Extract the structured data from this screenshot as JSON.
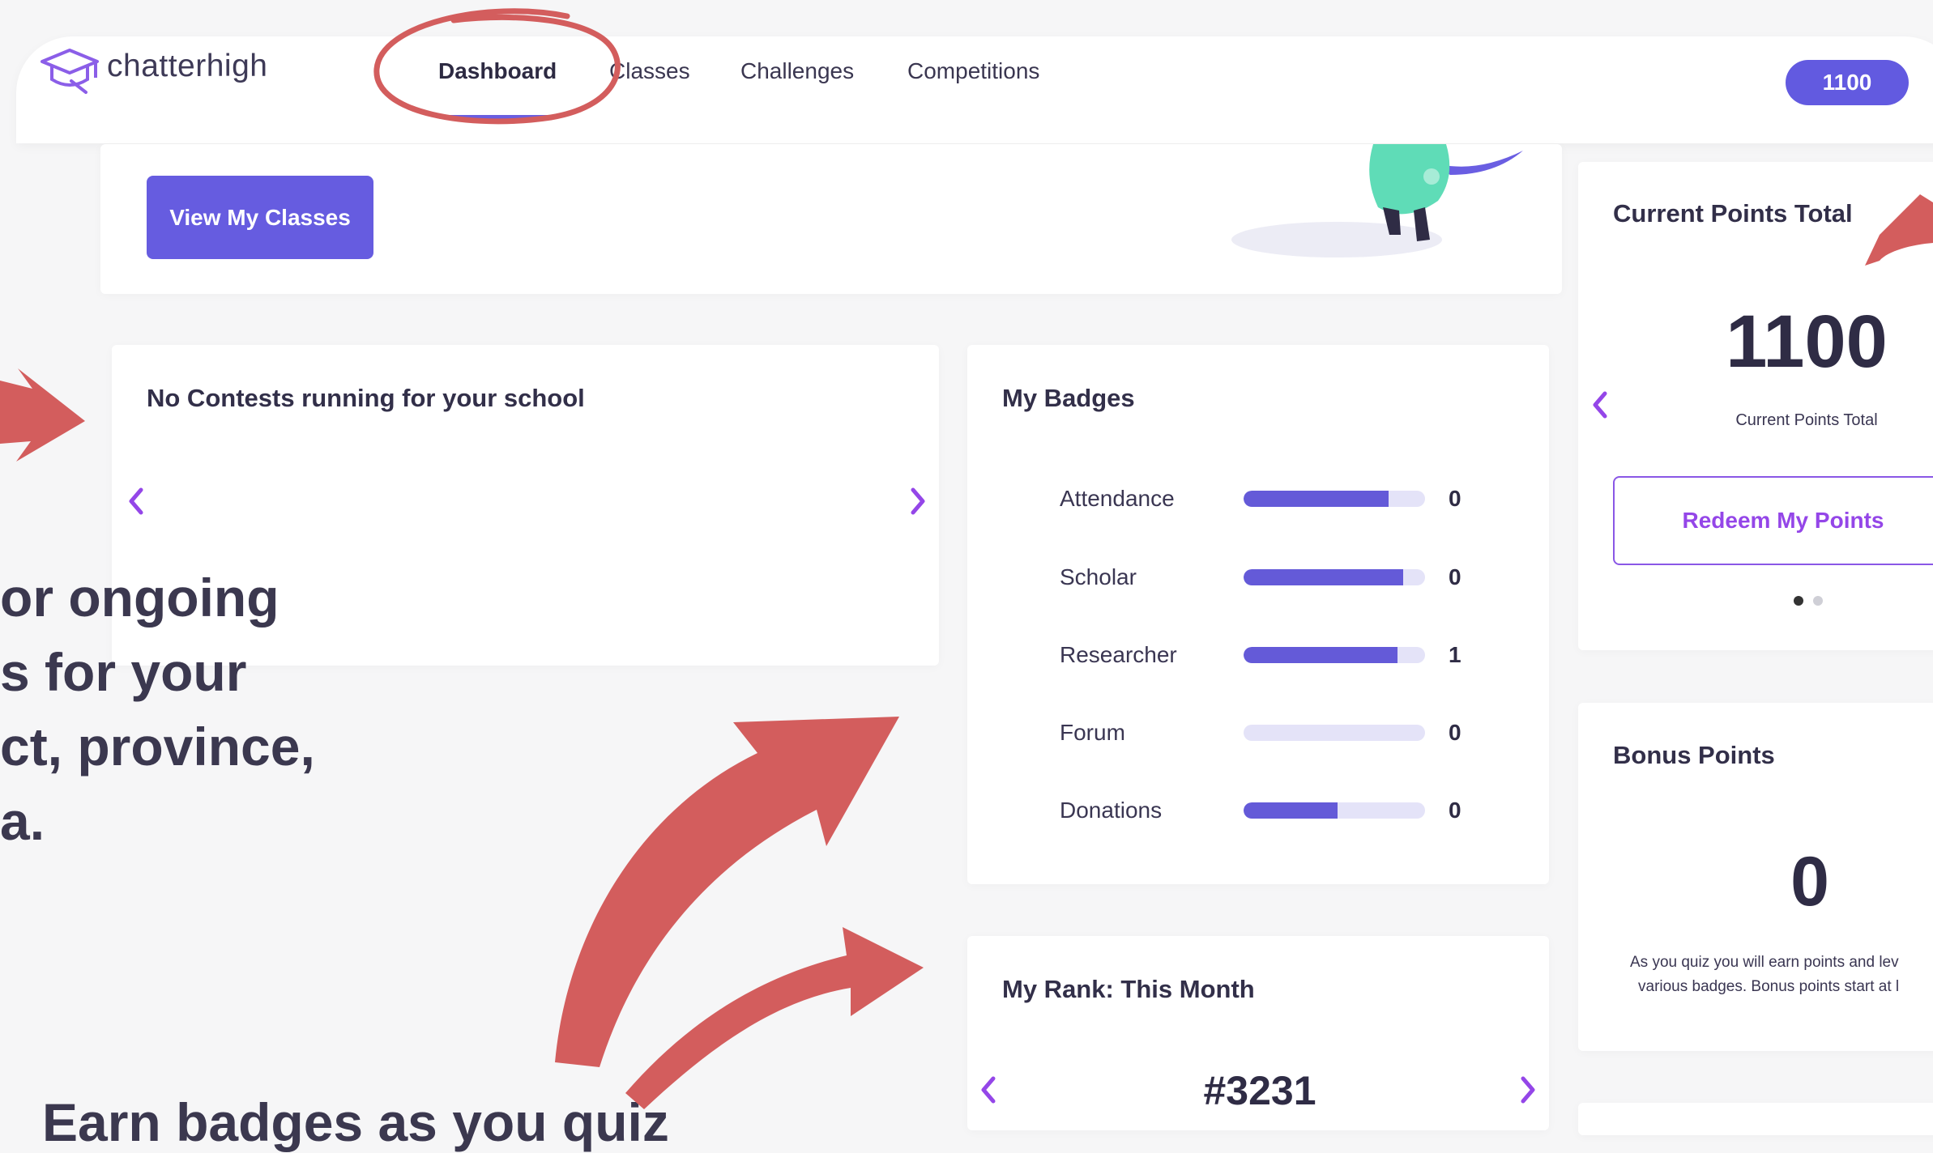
{
  "brand": {
    "name": "chatterhigh"
  },
  "nav": {
    "items": [
      "Dashboard",
      "Classes",
      "Challenges",
      "Competitions"
    ],
    "active": "Dashboard",
    "points_pill": "1100"
  },
  "hero": {
    "button_label": "View My Classes"
  },
  "contests": {
    "title": "No Contests running for your school"
  },
  "badges": {
    "title": "My Badges",
    "items": [
      {
        "label": "Attendance",
        "value": "0",
        "progress": 0.8
      },
      {
        "label": "Scholar",
        "value": "0",
        "progress": 0.88
      },
      {
        "label": "Researcher",
        "value": "1",
        "progress": 0.85
      },
      {
        "label": "Forum",
        "value": "0",
        "progress": 0
      },
      {
        "label": "Donations",
        "value": "0",
        "progress": 0.52
      }
    ]
  },
  "rank": {
    "title": "My Rank: This Month",
    "value": "#3231"
  },
  "points": {
    "title": "Current Points Total",
    "value": "1100",
    "caption": "Current Points Total",
    "redeem_label": "Redeem My Points"
  },
  "bonus": {
    "title": "Bonus Points",
    "value": "0",
    "description_line1": "As you quiz you will earn points and lev",
    "description_line2": "various badges. Bonus points start at l"
  },
  "annotations": {
    "left_text_lines": [
      "or ongoing",
      "s for your",
      "ct, province,",
      "a."
    ],
    "bottom_text": "Earn badges as you quiz"
  },
  "colors": {
    "accent": "#665ce0",
    "purple_text": "#9446e8",
    "annotation_red": "#d35d5d"
  }
}
